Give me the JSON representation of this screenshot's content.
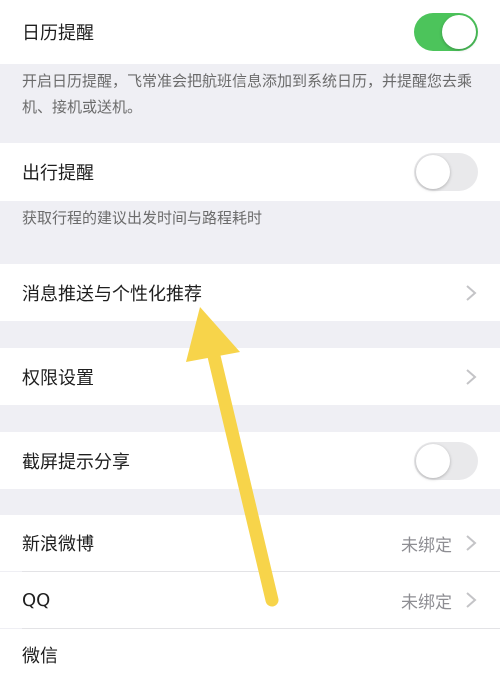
{
  "settings": {
    "calendar_reminder": {
      "label": "日历提醒",
      "enabled": true,
      "description": "开启日历提醒，飞常准会把航班信息添加到系统日历，并提醒您去乘机、接机或送机。"
    },
    "trip_reminder": {
      "label": "出行提醒",
      "enabled": false,
      "description": "获取行程的建议出发时间与路程耗时"
    },
    "push_personalization": {
      "label": "消息推送与个性化推荐"
    },
    "permissions": {
      "label": "权限设置"
    },
    "screenshot_share": {
      "label": "截屏提示分享",
      "enabled": false
    },
    "weibo": {
      "label": "新浪微博",
      "value": "未绑定"
    },
    "qq": {
      "label": "QQ",
      "value": "未绑定"
    },
    "wechat": {
      "label": "微信"
    }
  },
  "colors": {
    "toggle_on": "#4cc45b",
    "toggle_off": "#e9e9eb",
    "background": "#efeff4",
    "annotation_arrow": "#f7d44a"
  },
  "icons": {
    "chevron": "chevron-right-icon",
    "annotation": "yellow-arrow-annotation"
  }
}
